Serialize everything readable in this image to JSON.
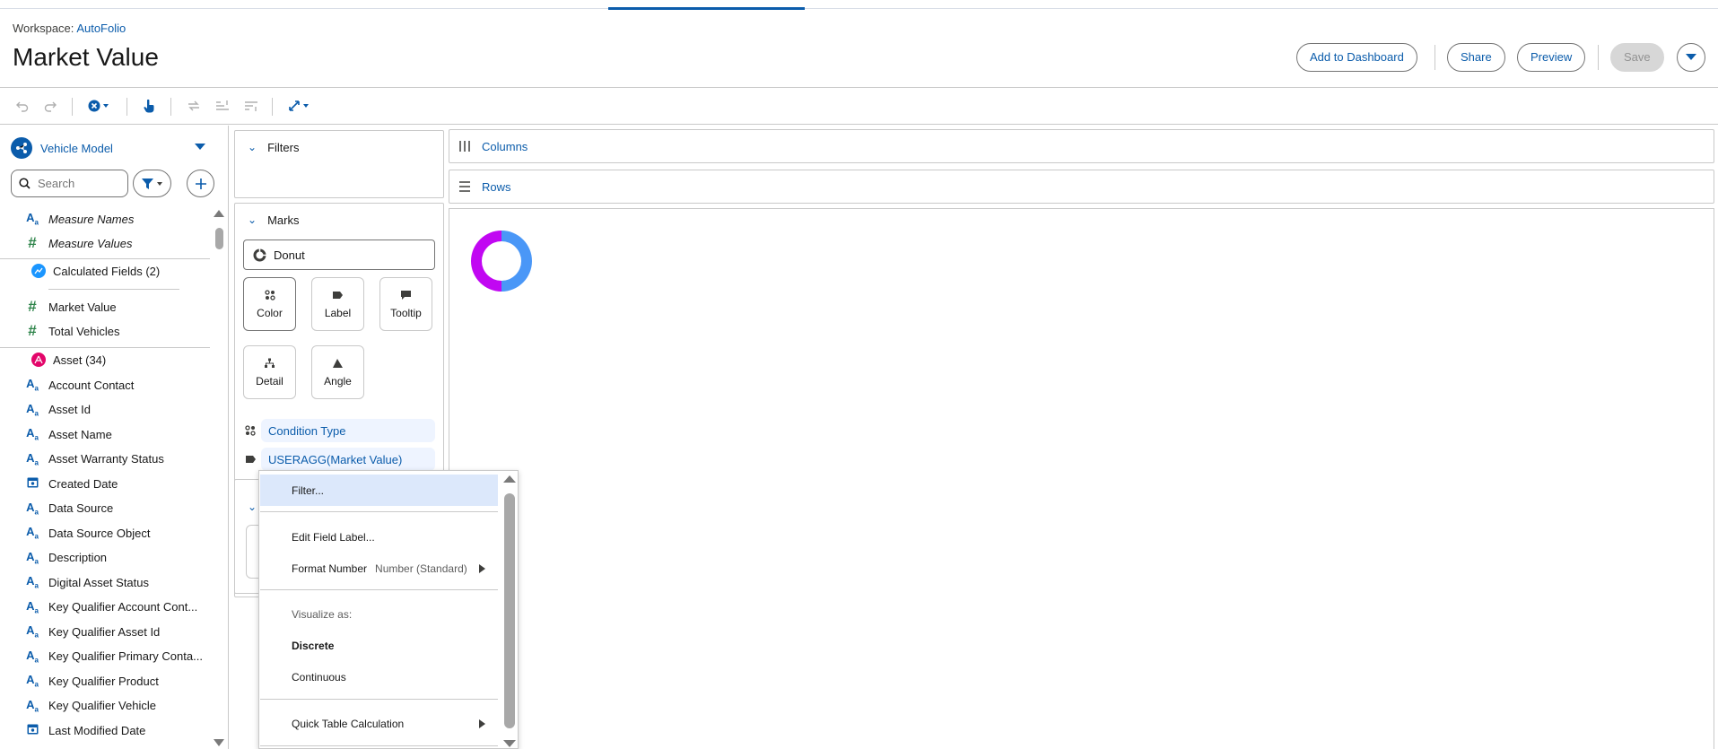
{
  "workspace": {
    "prefix": "Workspace:",
    "name": "AutoFolio"
  },
  "page": {
    "title": "Market Value"
  },
  "header_actions": {
    "add_to_dashboard": "Add to Dashboard",
    "share": "Share",
    "preview": "Preview",
    "save": "Save"
  },
  "toolbar": {
    "icons": [
      "undo-icon",
      "redo-icon",
      "clear-icon",
      "hand-pointer-icon",
      "swap-icon",
      "sort-ascending-icon",
      "sort-descending-icon",
      "fit-expand-icon"
    ]
  },
  "data_source": {
    "label": "Vehicle Model"
  },
  "search": {
    "placeholder": "Search"
  },
  "fields": {
    "measure_names": "Measure Names",
    "measure_values": "Measure Values",
    "calculated_group": "Calculated Fields (2)",
    "market_value": "Market Value",
    "total_vehicles": "Total Vehicles",
    "asset_group": "Asset (34)",
    "items": [
      {
        "label": "Account Contact",
        "type": "text"
      },
      {
        "label": "Asset Id",
        "type": "text"
      },
      {
        "label": "Asset Name",
        "type": "text"
      },
      {
        "label": "Asset Warranty Status",
        "type": "text"
      },
      {
        "label": "Created Date",
        "type": "date"
      },
      {
        "label": "Data Source",
        "type": "text"
      },
      {
        "label": "Data Source Object",
        "type": "text"
      },
      {
        "label": "Description",
        "type": "text"
      },
      {
        "label": "Digital Asset Status",
        "type": "text"
      },
      {
        "label": "Key Qualifier Account Cont...",
        "type": "text"
      },
      {
        "label": "Key Qualifier Asset Id",
        "type": "text"
      },
      {
        "label": "Key Qualifier Primary Conta...",
        "type": "text"
      },
      {
        "label": "Key Qualifier Product",
        "type": "text"
      },
      {
        "label": "Key Qualifier Vehicle",
        "type": "text"
      },
      {
        "label": "Last Modified Date",
        "type": "date"
      }
    ]
  },
  "filters_panel": {
    "title": "Filters"
  },
  "marks_panel": {
    "title": "Marks",
    "mark_type": "Donut",
    "properties": [
      "Color",
      "Label",
      "Tooltip",
      "Detail",
      "Angle"
    ],
    "pills": [
      "Condition Type",
      "USERAGG(Market Value)"
    ]
  },
  "shelves": {
    "columns": "Columns",
    "rows": "Rows"
  },
  "chart_data": {
    "type": "pie",
    "style": "donut",
    "slices": [
      {
        "color": "#4a97f7",
        "value": 50
      },
      {
        "color": "#c107f2",
        "value": 50
      }
    ]
  },
  "context_menu": {
    "filter": "Filter...",
    "edit_field_label": "Edit Field Label...",
    "format_number": "Format Number",
    "format_number_value": "Number (Standard)",
    "visualize_as": "Visualize as:",
    "discrete": "Discrete",
    "continuous": "Continuous",
    "quick_table_calculation": "Quick Table Calculation"
  }
}
